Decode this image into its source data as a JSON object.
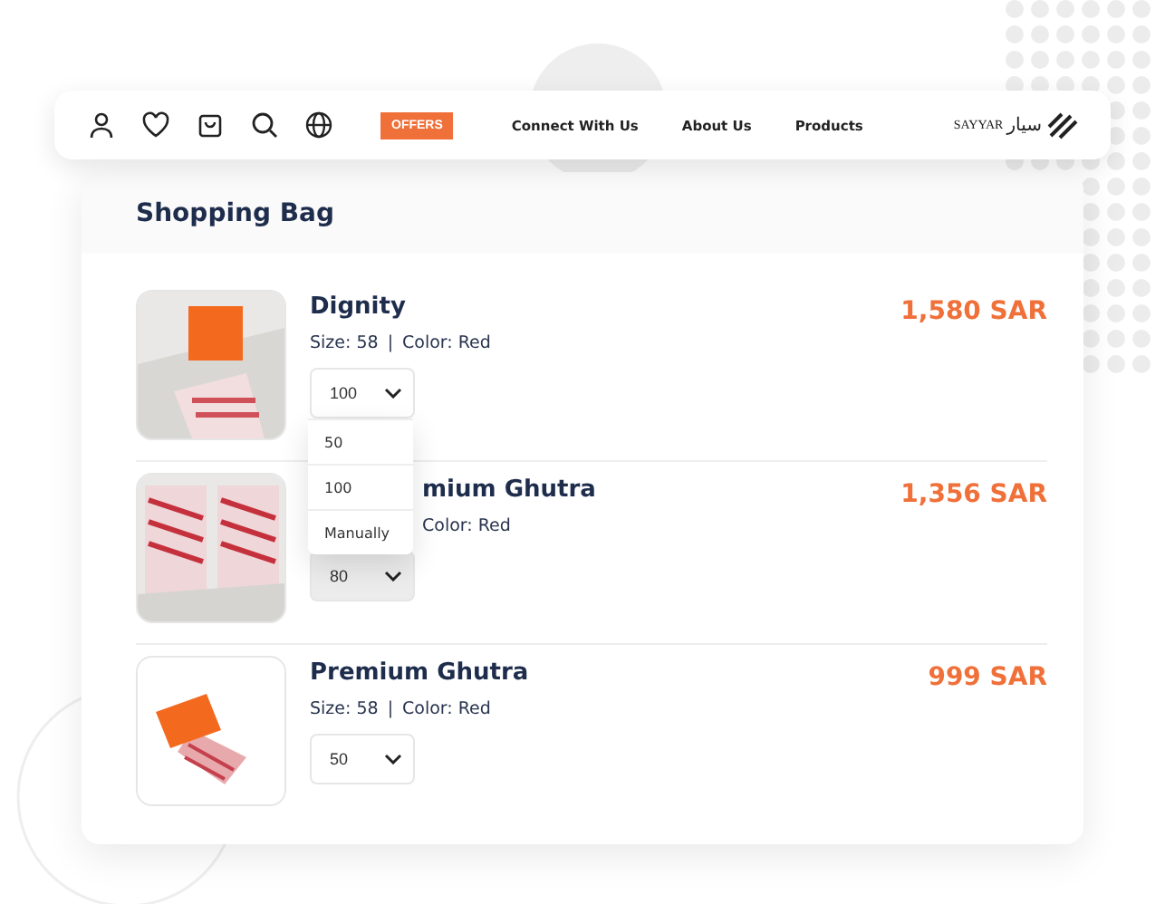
{
  "nav": {
    "offers": "OFFERS",
    "links": [
      "Connect With Us",
      "About Us",
      "Products"
    ],
    "logo": {
      "latin": "SAYYAR",
      "arabic": "سيار"
    }
  },
  "bag": {
    "title": "Shopping Bag",
    "items": [
      {
        "name": "Dignity",
        "size": "Size: 58",
        "separator": "|",
        "color_label": "Color: Red",
        "quantity": "100",
        "price": "1,580 SAR",
        "highlighted": false,
        "menu": {
          "options": [
            "50",
            "100",
            "Manually"
          ]
        }
      },
      {
        "name": "mium Ghutra",
        "color_label": "Color: Red",
        "quantity": "80",
        "price": "1,356 SAR",
        "highlighted": true
      },
      {
        "name": "Premium Ghutra",
        "size": "Size: 58",
        "separator": "|",
        "color_label": "Color: Red",
        "quantity": "50",
        "price": "999 SAR",
        "highlighted": false
      }
    ]
  }
}
